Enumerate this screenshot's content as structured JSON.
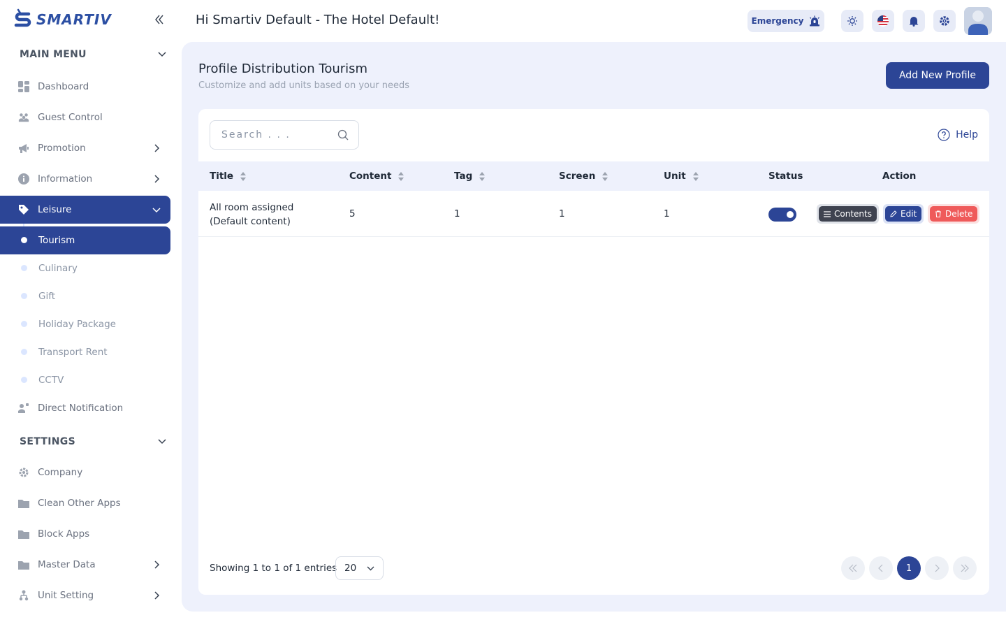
{
  "app": {
    "brand": "SMARTIV",
    "greeting": "Hi Smartiv Default - The Hotel Default!"
  },
  "header": {
    "emergency_label": "Emergency"
  },
  "sidebar": {
    "main_menu_label": "MAIN MENU",
    "settings_label": "SETTINGS",
    "items": [
      {
        "label": "Dashboard"
      },
      {
        "label": "Guest Control"
      },
      {
        "label": "Promotion"
      },
      {
        "label": "Information"
      },
      {
        "label": "Leisure"
      },
      {
        "label": "Direct Notification"
      }
    ],
    "leisure_sub": [
      {
        "label": "Tourism"
      },
      {
        "label": "Culinary"
      },
      {
        "label": "Gift"
      },
      {
        "label": "Holiday Package"
      },
      {
        "label": "Transport Rent"
      },
      {
        "label": "CCTV"
      }
    ],
    "settings_items": [
      {
        "label": "Company"
      },
      {
        "label": "Clean Other Apps"
      },
      {
        "label": "Block Apps"
      },
      {
        "label": "Master Data"
      },
      {
        "label": "Unit Setting"
      }
    ]
  },
  "page": {
    "title": "Profile Distribution Tourism",
    "subtitle": "Customize and add units based on your needs",
    "add_button": "Add New Profile"
  },
  "table": {
    "search_placeholder": "Search . . .",
    "help_label": "Help",
    "columns": [
      "Title",
      "Content",
      "Tag",
      "Screen",
      "Unit",
      "Status",
      "Action"
    ],
    "rows": [
      {
        "title_line1": "All room assigned",
        "title_line2": "(Default content)",
        "content": "5",
        "tag": "1",
        "screen": "1",
        "unit": "1",
        "status": true
      }
    ],
    "actions": {
      "contents": "Contents",
      "edit": "Edit",
      "delete": "Delete"
    },
    "footer": {
      "showing": "Showing 1 to 1 of 1 entries",
      "page_size": "20",
      "current_page": "1"
    }
  },
  "colors": {
    "primary": "#2c4596",
    "danger": "#ef5a5a",
    "background": "#eef1fc"
  }
}
